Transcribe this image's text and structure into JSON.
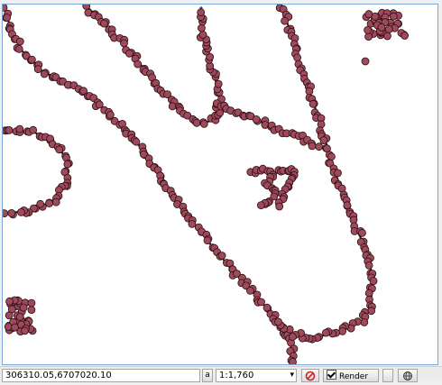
{
  "map": {
    "feature_label": "37",
    "point_fill": "#9e4a5a",
    "point_stroke": "#2b0d14",
    "line_color": "#1a1a1a",
    "vertex_color": "#1e4fa0"
  },
  "statusbar": {
    "coordinate": "306310.05,6707020.10",
    "coord_icon": "cursor-coord-icon",
    "scale": "1:1,760",
    "scale_dropdown_icon": "chevron-down-icon",
    "stop_render_icon": "no-entry-icon",
    "render_label": "Render",
    "extra_button_label": "",
    "crs_icon": "globe-icon"
  }
}
